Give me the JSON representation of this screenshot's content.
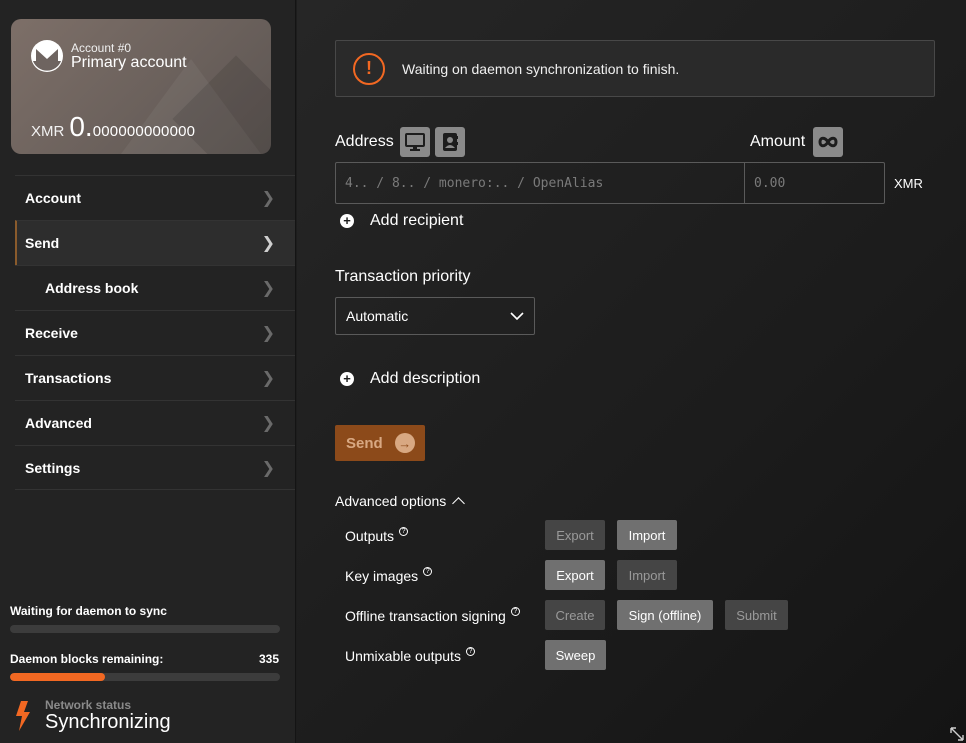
{
  "account_card": {
    "account_number": "Account #0",
    "account_name": "Primary account",
    "currency": "XMR",
    "balance_integer": "0.",
    "balance_decimal": "000000000000"
  },
  "sidebar": {
    "items": [
      {
        "label": "Account",
        "active": false,
        "sub": false
      },
      {
        "label": "Send",
        "active": true,
        "sub": false
      },
      {
        "label": "Address book",
        "active": false,
        "sub": true
      },
      {
        "label": "Receive",
        "active": false,
        "sub": false
      },
      {
        "label": "Transactions",
        "active": false,
        "sub": false
      },
      {
        "label": "Advanced",
        "active": false,
        "sub": false
      },
      {
        "label": "Settings",
        "active": false,
        "sub": false
      }
    ],
    "sync_label": "Waiting for daemon to sync",
    "sync_progress": 0,
    "blocks_label": "Daemon blocks remaining:",
    "blocks_remaining": "335",
    "blocks_progress": 0.35,
    "network_status_title": "Network status",
    "network_status_value": "Synchronizing"
  },
  "main": {
    "warning_text": "Waiting on daemon synchronization to finish.",
    "address_label": "Address",
    "amount_label": "Amount",
    "address_placeholder": "4.. / 8.. / monero:.. / OpenAlias",
    "amount_placeholder": "0.00",
    "currency_suffix": "XMR",
    "add_recipient": "Add recipient",
    "priority_label": "Transaction priority",
    "priority_value": "Automatic",
    "add_description": "Add description",
    "send_label": "Send",
    "advanced_options": "Advanced options",
    "options": {
      "outputs": "Outputs",
      "key_images": "Key images",
      "offline_signing": "Offline transaction signing",
      "unmixable": "Unmixable outputs"
    },
    "buttons": {
      "export": "Export",
      "import": "Import",
      "create": "Create",
      "sign_offline": "Sign (offline)",
      "submit": "Submit",
      "sweep": "Sweep"
    }
  },
  "colors": {
    "accent": "#f26822",
    "send_button": "#8c4a1a"
  }
}
